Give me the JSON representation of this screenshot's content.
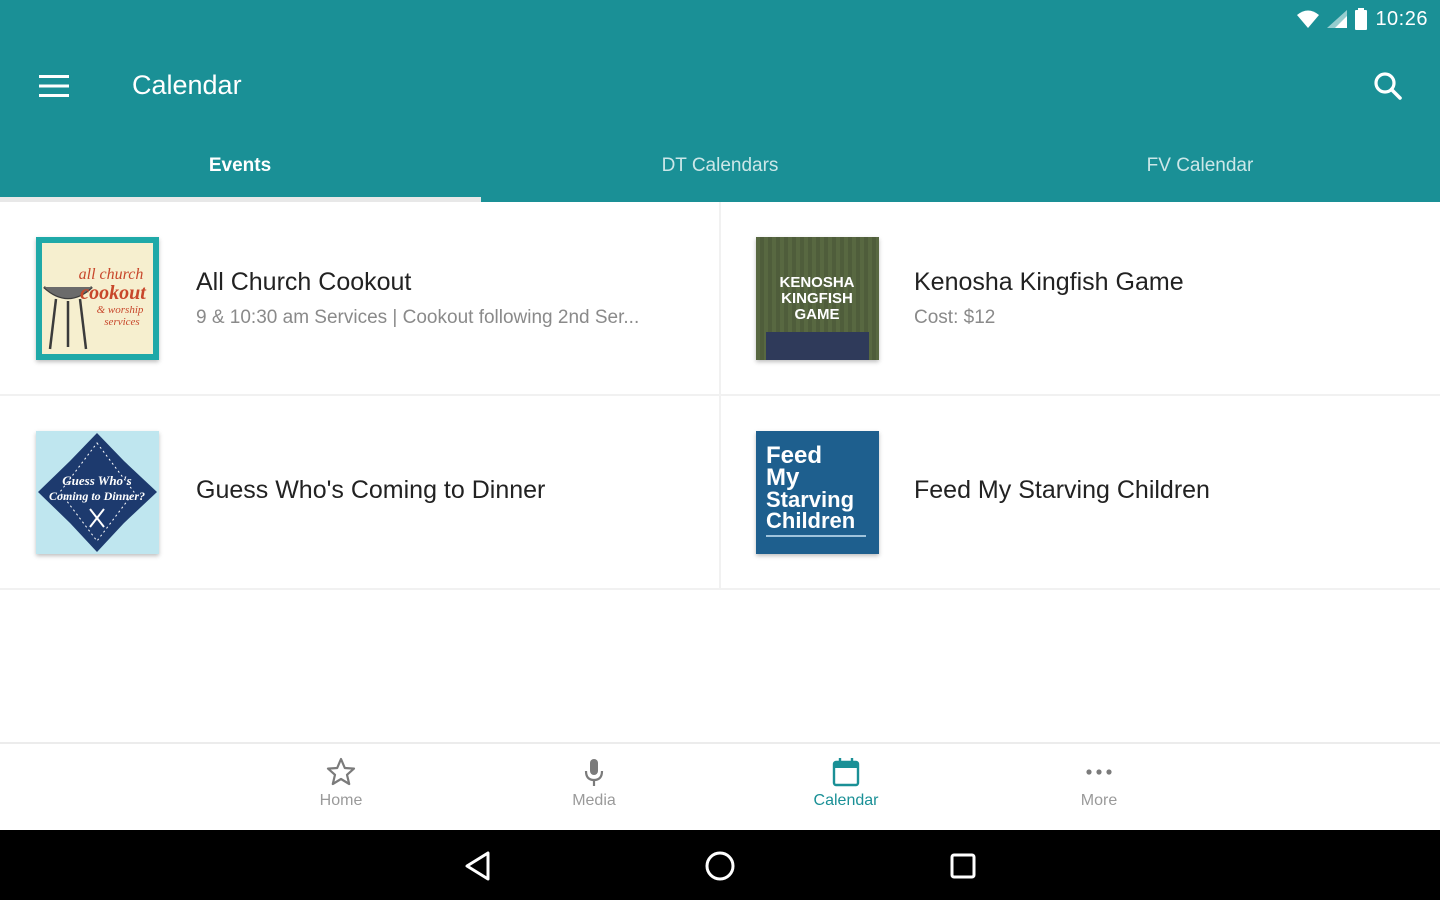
{
  "status": {
    "time": "10:26"
  },
  "appbar": {
    "title": "Calendar"
  },
  "tabs": [
    {
      "label": "Events",
      "active": true
    },
    {
      "label": "DT Calendars",
      "active": false
    },
    {
      "label": "FV Calendar",
      "active": false
    }
  ],
  "events": [
    {
      "title": "All Church Cookout",
      "subtitle": "9 & 10:30 am Services | Cookout following 2nd Ser...",
      "thumb_text": [
        "all church",
        "cookout",
        "& worship",
        "services"
      ]
    },
    {
      "title": "Kenosha Kingfish Game",
      "subtitle": "Cost: $12",
      "thumb_text": [
        "KENOSHA",
        "KINGFISH",
        "GAME"
      ]
    },
    {
      "title": "Guess Who's Coming to Dinner",
      "subtitle": "",
      "thumb_text": [
        "Guess Who's",
        "Coming to Dinner?"
      ]
    },
    {
      "title": "Feed My Starving Children",
      "subtitle": "",
      "thumb_text": [
        "Feed",
        "My",
        "Starving",
        "Children"
      ]
    }
  ],
  "bottom_nav": [
    {
      "label": "Home",
      "icon": "star-icon",
      "active": false
    },
    {
      "label": "Media",
      "icon": "microphone-icon",
      "active": false
    },
    {
      "label": "Calendar",
      "icon": "calendar-icon",
      "active": true
    },
    {
      "label": "More",
      "icon": "more-dots-icon",
      "active": false
    }
  ],
  "colors": {
    "primary": "#1a9096",
    "background": "#ffffff",
    "title_text": "#222222",
    "subtitle_text": "#8a8a8a"
  }
}
